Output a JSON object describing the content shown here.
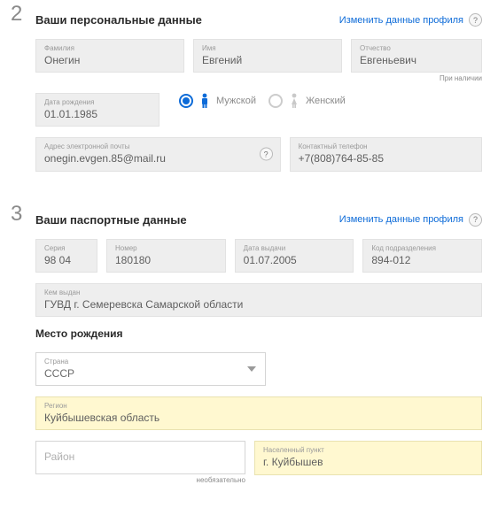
{
  "section2": {
    "title": "Ваши персональные данные",
    "edit": "Изменить данные профиля",
    "surname": {
      "label": "Фамилия",
      "value": "Онегин"
    },
    "name": {
      "label": "Имя",
      "value": "Евгений"
    },
    "patronymic": {
      "label": "Отчество",
      "value": "Евгеньевич"
    },
    "patronymic_hint": "При наличии",
    "dob": {
      "label": "Дата рождения",
      "value": "01.01.1985"
    },
    "gender": {
      "male": "Мужской",
      "female": "Женский"
    },
    "email": {
      "label": "Адрес электронной почты",
      "value": "onegin.evgen.85@mail.ru"
    },
    "phone": {
      "label": "Контактный телефон",
      "value": "+7(808)764-85-85"
    }
  },
  "section3": {
    "title": "Ваши паспортные данные",
    "edit": "Изменить данные профиля",
    "series": {
      "label": "Серия",
      "value": "98 04"
    },
    "number": {
      "label": "Номер",
      "value": "180180"
    },
    "issued_date": {
      "label": "Дата выдачи",
      "value": "01.07.2005"
    },
    "division_code": {
      "label": "Код подразделения",
      "value": "894-012"
    },
    "issued_by": {
      "label": "Кем выдан",
      "value": "ГУВД г. Семеревска Самарской области"
    },
    "birthplace_title": "Место рождения",
    "country": {
      "label": "Страна",
      "value": "СССР"
    },
    "region": {
      "label": "Регион",
      "value": "Куйбышевская область"
    },
    "district": {
      "label": "Район",
      "value": "",
      "hint": "необязательно"
    },
    "locality": {
      "label": "Населенный пункт",
      "value": "г. Куйбышев"
    }
  },
  "qmark": "?"
}
